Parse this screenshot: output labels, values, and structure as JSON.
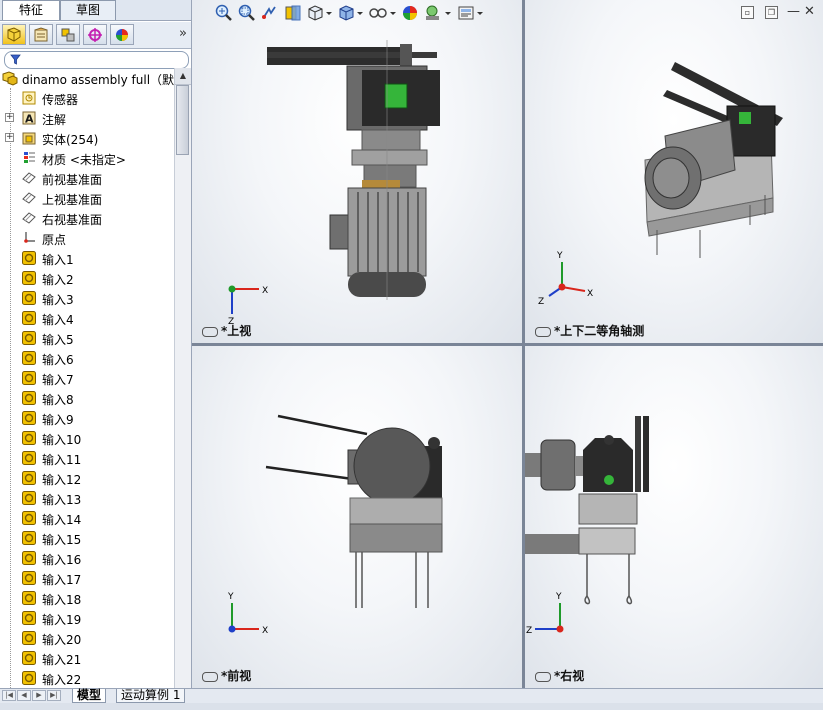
{
  "manager_tabs": {
    "features": "特征",
    "sketch": "草图"
  },
  "panel_icons": [
    "feature-manager-icon",
    "property-manager-icon",
    "configuration-manager-icon",
    "dimxpert-icon",
    "display-manager-icon"
  ],
  "tree": {
    "root": "dinamo assembly full（默认",
    "items": [
      {
        "label": "传感器",
        "icon": "sensor-icon",
        "expander": false
      },
      {
        "label": "注解",
        "icon": "annotation-icon",
        "expander": true
      },
      {
        "label": "实体(254)",
        "icon": "solid-bodies-icon",
        "expander": true
      },
      {
        "label": "材质 <未指定>",
        "icon": "material-icon",
        "expander": false
      },
      {
        "label": "前视基准面",
        "icon": "plane-icon",
        "expander": false
      },
      {
        "label": "上视基准面",
        "icon": "plane-icon",
        "expander": false
      },
      {
        "label": "右视基准面",
        "icon": "plane-icon",
        "expander": false
      },
      {
        "label": "原点",
        "icon": "origin-icon",
        "expander": false
      },
      {
        "label": "输入1",
        "icon": "imported-part-icon",
        "expander": false
      },
      {
        "label": "输入2",
        "icon": "imported-part-icon",
        "expander": false
      },
      {
        "label": "输入3",
        "icon": "imported-part-icon",
        "expander": false
      },
      {
        "label": "输入4",
        "icon": "imported-part-icon",
        "expander": false
      },
      {
        "label": "输入5",
        "icon": "imported-part-icon",
        "expander": false
      },
      {
        "label": "输入6",
        "icon": "imported-part-icon",
        "expander": false
      },
      {
        "label": "输入7",
        "icon": "imported-part-icon",
        "expander": false
      },
      {
        "label": "输入8",
        "icon": "imported-part-icon",
        "expander": false
      },
      {
        "label": "输入9",
        "icon": "imported-part-icon",
        "expander": false
      },
      {
        "label": "输入10",
        "icon": "imported-part-icon",
        "expander": false
      },
      {
        "label": "输入11",
        "icon": "imported-part-icon",
        "expander": false
      },
      {
        "label": "输入12",
        "icon": "imported-part-icon",
        "expander": false
      },
      {
        "label": "输入13",
        "icon": "imported-part-icon",
        "expander": false
      },
      {
        "label": "输入14",
        "icon": "imported-part-icon",
        "expander": false
      },
      {
        "label": "输入15",
        "icon": "imported-part-icon",
        "expander": false
      },
      {
        "label": "输入16",
        "icon": "imported-part-icon",
        "expander": false
      },
      {
        "label": "输入17",
        "icon": "imported-part-icon",
        "expander": false
      },
      {
        "label": "输入18",
        "icon": "imported-part-icon",
        "expander": false
      },
      {
        "label": "输入19",
        "icon": "imported-part-icon",
        "expander": false
      },
      {
        "label": "输入20",
        "icon": "imported-part-icon",
        "expander": false
      },
      {
        "label": "输入21",
        "icon": "imported-part-icon",
        "expander": false
      },
      {
        "label": "输入22",
        "icon": "imported-part-icon",
        "expander": false
      }
    ]
  },
  "viewports": [
    {
      "label": "*上视",
      "view": "top"
    },
    {
      "label": "*上下二等角轴测",
      "view": "dimetric"
    },
    {
      "label": "*前视",
      "view": "front"
    },
    {
      "label": "*右视",
      "view": "right"
    }
  ],
  "axes": {
    "x": "X",
    "y": "Y",
    "z": "Z",
    "x_color": "#d9261c",
    "y_color": "#1f9a2a",
    "z_color": "#1e3fc8"
  },
  "bottom_tabs": {
    "model": "模型",
    "motion_study": "运动算例 1"
  },
  "hud_icons": [
    "zoom-to-fit-icon",
    "zoom-to-area-icon",
    "previous-view-icon",
    "section-view-icon",
    "view-orientation-icon",
    "display-style-icon",
    "hide-show-items-icon",
    "edit-appearance-icon",
    "apply-scene-icon",
    "view-settings-icon"
  ],
  "colors": {
    "panel_active_icon": "#f1c21b",
    "imported_part_fill": "#f2c200",
    "motor_gray": "#6e6e6e"
  }
}
